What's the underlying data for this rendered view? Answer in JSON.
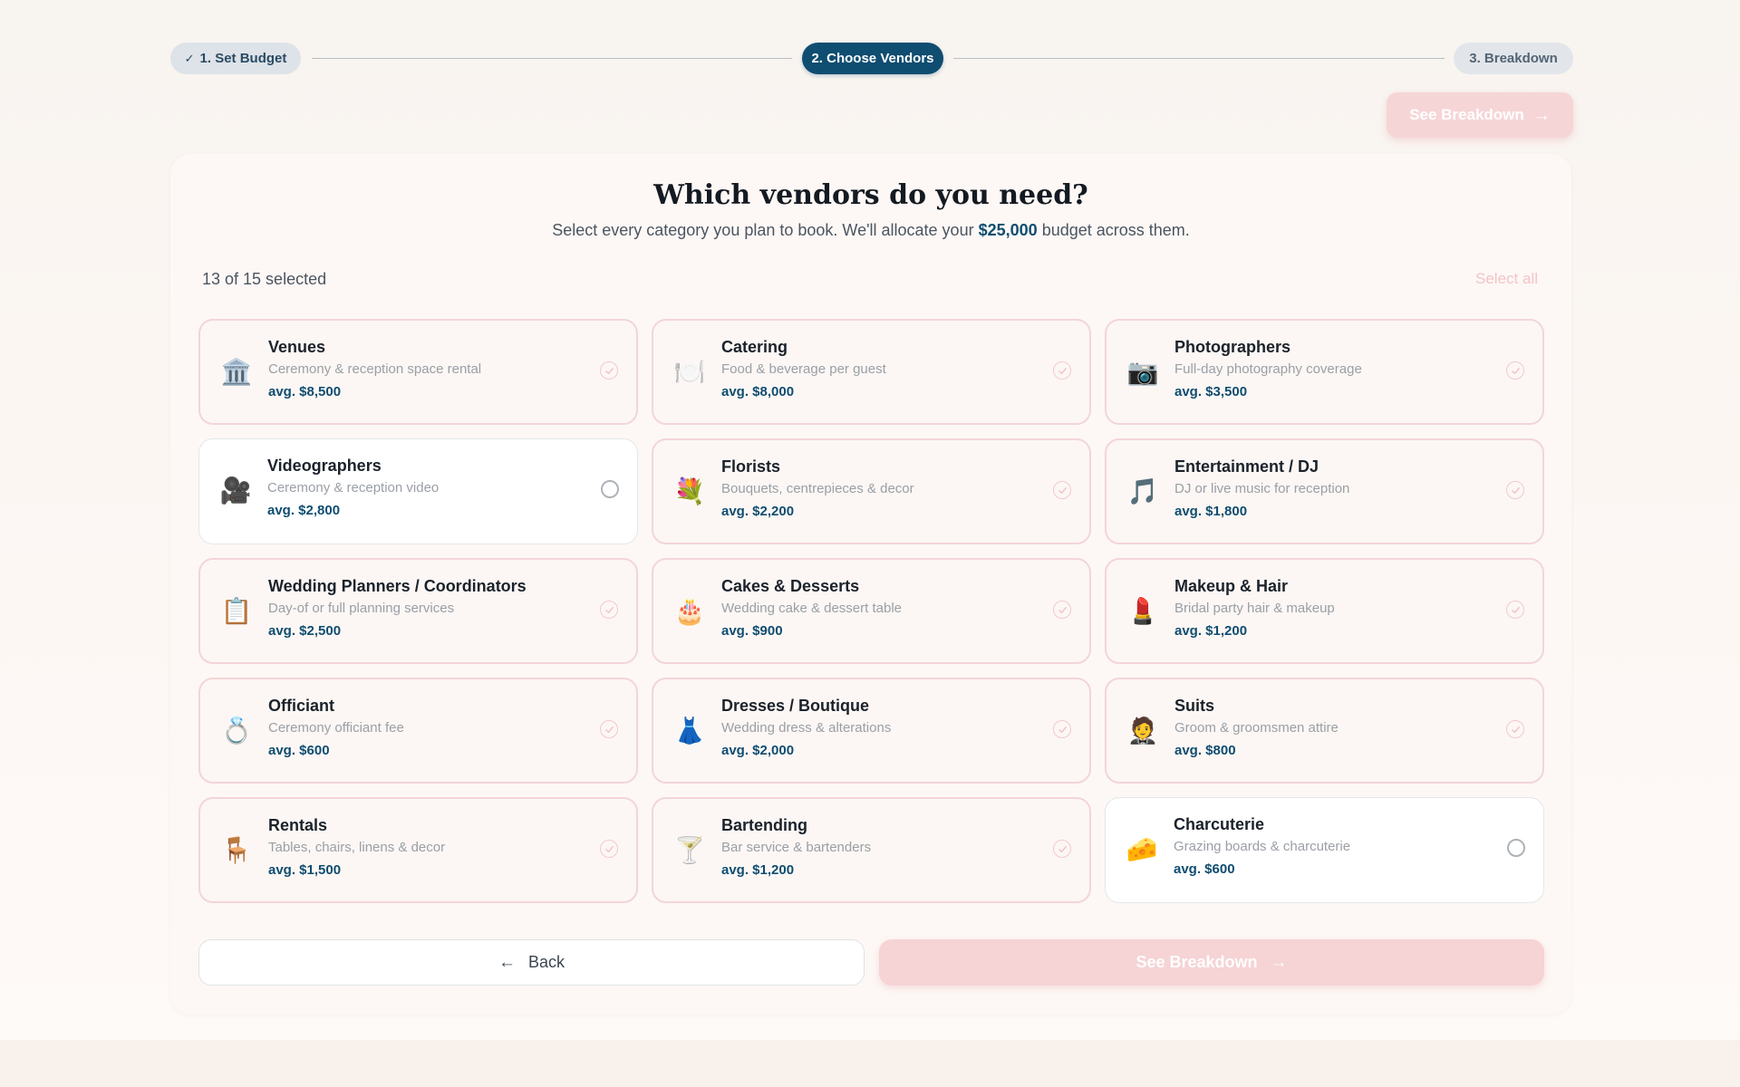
{
  "stepper": {
    "steps": [
      {
        "label": "1. Set Budget",
        "status": "done"
      },
      {
        "label": "2. Choose Vendors",
        "status": "active"
      },
      {
        "label": "3. Breakdown",
        "status": "upcoming"
      }
    ]
  },
  "top_cta": {
    "label": "See Breakdown",
    "enabled": false
  },
  "header": {
    "title": "Which vendors do you need?",
    "subtitle_before": "Select every category you plan to book. We'll allocate your",
    "budget": "$25,000",
    "subtitle_after": "budget across them."
  },
  "selection": {
    "count_text": "13 of 15 selected",
    "select_all_label": "Select all"
  },
  "vendors": [
    {
      "name": "Venues",
      "desc": "Ceremony & reception space rental",
      "avg": "avg. $8,500",
      "icon": "classical-building-icon",
      "glyph": "🏛️",
      "selected": true
    },
    {
      "name": "Catering",
      "desc": "Food & beverage per guest",
      "avg": "avg. $8,000",
      "icon": "plate-cutlery-icon",
      "glyph": "🍽️",
      "selected": true
    },
    {
      "name": "Photographers",
      "desc": "Full-day photography coverage",
      "avg": "avg. $3,500",
      "icon": "camera-icon",
      "glyph": "📷",
      "selected": true
    },
    {
      "name": "Videographers",
      "desc": "Ceremony & reception video",
      "avg": "avg. $2,800",
      "icon": "movie-camera-icon",
      "glyph": "🎥",
      "selected": false
    },
    {
      "name": "Florists",
      "desc": "Bouquets, centrepieces & decor",
      "avg": "avg. $2,200",
      "icon": "bouquet-icon",
      "glyph": "💐",
      "selected": true
    },
    {
      "name": "Entertainment / DJ",
      "desc": "DJ or live music for reception",
      "avg": "avg. $1,800",
      "icon": "music-note-icon",
      "glyph": "🎵",
      "selected": true
    },
    {
      "name": "Wedding Planners / Coordinators",
      "desc": "Day-of or full planning services",
      "avg": "avg. $2,500",
      "icon": "clipboard-icon",
      "glyph": "📋",
      "selected": true
    },
    {
      "name": "Cakes & Desserts",
      "desc": "Wedding cake & dessert table",
      "avg": "avg. $900",
      "icon": "cake-icon",
      "glyph": "🎂",
      "selected": true
    },
    {
      "name": "Makeup & Hair",
      "desc": "Bridal party hair & makeup",
      "avg": "avg. $1,200",
      "icon": "lipstick-icon",
      "glyph": "💄",
      "selected": true
    },
    {
      "name": "Officiant",
      "desc": "Ceremony officiant fee",
      "avg": "avg. $600",
      "icon": "ring-icon",
      "glyph": "💍",
      "selected": true
    },
    {
      "name": "Dresses / Boutique",
      "desc": "Wedding dress & alterations",
      "avg": "avg. $2,000",
      "icon": "dress-icon",
      "glyph": "👗",
      "selected": true
    },
    {
      "name": "Suits",
      "desc": "Groom & groomsmen attire",
      "avg": "avg. $800",
      "icon": "man-in-tuxedo-icon",
      "glyph": "🤵",
      "selected": true
    },
    {
      "name": "Rentals",
      "desc": "Tables, chairs, linens & decor",
      "avg": "avg. $1,500",
      "icon": "chair-icon",
      "glyph": "🪑",
      "selected": true
    },
    {
      "name": "Bartending",
      "desc": "Bar service & bartenders",
      "avg": "avg. $1,200",
      "icon": "cocktail-glass-icon",
      "glyph": "🍸",
      "selected": true
    },
    {
      "name": "Charcuterie",
      "desc": "Grazing boards & charcuterie",
      "avg": "avg. $600",
      "icon": "cheese-icon",
      "glyph": "🧀",
      "selected": false
    }
  ],
  "footer": {
    "back_label": "Back",
    "next_label": "See Breakdown"
  },
  "colors": {
    "accent": "#0f4d71",
    "selected_border": "#f3d5d8",
    "cta_disabled": "#f6d3d5",
    "page_bg": "#f8f4f0"
  }
}
